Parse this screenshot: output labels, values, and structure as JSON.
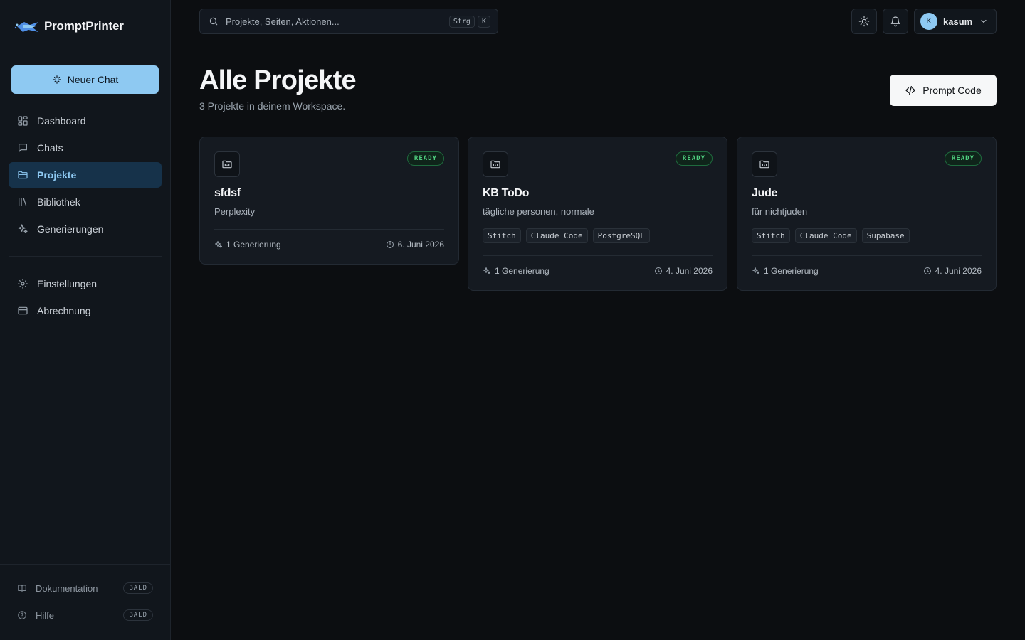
{
  "app": {
    "name": "PromptPrinter"
  },
  "sidebar": {
    "new_chat_label": "Neuer Chat",
    "nav": [
      {
        "label": "Dashboard",
        "icon": "dashboard-icon"
      },
      {
        "label": "Chats",
        "icon": "chat-icon"
      },
      {
        "label": "Projekte",
        "icon": "folder-icon",
        "active": true
      },
      {
        "label": "Bibliothek",
        "icon": "library-icon"
      },
      {
        "label": "Generierungen",
        "icon": "sparkles-icon"
      }
    ],
    "nav2": [
      {
        "label": "Einstellungen",
        "icon": "gear-icon"
      },
      {
        "label": "Abrechnung",
        "icon": "credit-card-icon"
      }
    ],
    "footer": [
      {
        "label": "Dokumentation",
        "badge": "BALD",
        "icon": "book-icon"
      },
      {
        "label": "Hilfe",
        "badge": "BALD",
        "icon": "help-icon"
      }
    ]
  },
  "topbar": {
    "search_placeholder": "Projekte, Seiten, Aktionen...",
    "shortcut_keys": [
      "Strg",
      "K"
    ],
    "user": {
      "initial": "K",
      "name": "kasum"
    }
  },
  "main": {
    "title": "Alle Projekte",
    "subtitle": "3 Projekte in deinem Workspace.",
    "prompt_code_label": "Prompt Code",
    "projects": [
      {
        "name": "sfdsf",
        "description": "Perplexity",
        "status": "READY",
        "tags": [],
        "generations": "1 Generierung",
        "date": "6. Juni 2026"
      },
      {
        "name": "KB ToDo",
        "description": "tägliche personen, normale",
        "status": "READY",
        "tags": [
          "Stitch",
          "Claude Code",
          "PostgreSQL"
        ],
        "generations": "1 Generierung",
        "date": "4. Juni 2026"
      },
      {
        "name": "Jude",
        "description": "für nichtjuden",
        "status": "READY",
        "tags": [
          "Stitch",
          "Claude Code",
          "Supabase"
        ],
        "generations": "1 Generierung",
        "date": "4. Juni 2026"
      }
    ]
  },
  "colors": {
    "accent": "#8ec9f2",
    "background": "#0c0e11",
    "sidebar": "#11161c",
    "ready": "#4fcf7f"
  }
}
